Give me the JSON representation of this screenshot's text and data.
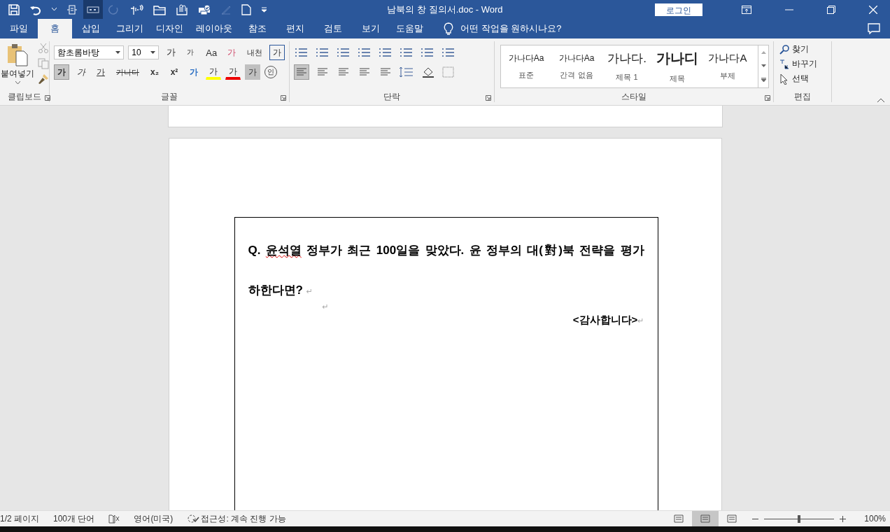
{
  "title_bar": {
    "title": "남북의 창 질의서.doc  -  Word",
    "login": "로그인"
  },
  "tabs": [
    {
      "label": "파일",
      "selected": false
    },
    {
      "label": "홈",
      "selected": true
    },
    {
      "label": "삽입",
      "selected": false
    },
    {
      "label": "그리기",
      "selected": false
    },
    {
      "label": "디자인",
      "selected": false
    },
    {
      "label": "레이아웃",
      "selected": false
    },
    {
      "label": "참조",
      "selected": false
    },
    {
      "label": "편지",
      "selected": false
    },
    {
      "label": "검토",
      "selected": false
    },
    {
      "label": "보기",
      "selected": false
    },
    {
      "label": "도움말",
      "selected": false
    }
  ],
  "tell_me": "어떤 작업을 원하시나요?",
  "clipboard": {
    "paste": "붙여넣기",
    "group": "클립보드"
  },
  "font": {
    "name": "함초롬바탕",
    "size": "10",
    "group": "글꼴",
    "row1": [
      {
        "label": "가",
        "kind": "grow"
      },
      {
        "label": "가",
        "kind": "shrink"
      },
      {
        "label": "Aa",
        "kind": "case"
      },
      {
        "label": "가",
        "kind": "clear"
      },
      {
        "label": "내천",
        "kind": "phonetic"
      },
      {
        "label": "가",
        "kind": "border"
      }
    ],
    "row2": [
      {
        "label": "가",
        "kind": "bold",
        "selected": true
      },
      {
        "label": "가",
        "kind": "italic",
        "selected": false
      },
      {
        "label": "가",
        "kind": "underline",
        "selected": false
      },
      {
        "label": "가나다",
        "kind": "strike",
        "selected": false
      },
      {
        "label": "x₂",
        "kind": "sub",
        "selected": false
      },
      {
        "label": "x²",
        "kind": "sup",
        "selected": false
      },
      {
        "label": "가",
        "kind": "effect",
        "selected": false
      },
      {
        "label": "가",
        "kind": "highlight",
        "selected": false
      },
      {
        "label": "가",
        "kind": "color",
        "selected": false
      },
      {
        "label": "가",
        "kind": "shade",
        "selected": false
      },
      {
        "label": "인",
        "kind": "enclose",
        "selected": false
      }
    ]
  },
  "paragraph": {
    "group": "단락",
    "align": [
      {
        "selected": true
      },
      {
        "selected": false
      },
      {
        "selected": false
      },
      {
        "selected": false
      },
      {
        "selected": false
      }
    ]
  },
  "styles": {
    "group": "스타일",
    "items": [
      {
        "preview": "가나다Aa",
        "name": "표준",
        "kind": "small"
      },
      {
        "preview": "가나다Aa",
        "name": "간격 없음",
        "kind": "small"
      },
      {
        "preview": "가나다.",
        "name": "제목 1",
        "kind": "heading"
      },
      {
        "preview": "가나디",
        "name": "제목",
        "kind": "title"
      },
      {
        "preview": "가나다A",
        "name": "부제",
        "kind": "subtitle"
      }
    ]
  },
  "editing": {
    "group": "편집",
    "items": [
      {
        "label": "찾기",
        "kind": "find"
      },
      {
        "label": "바꾸기",
        "kind": "replace"
      },
      {
        "label": "선택",
        "kind": "select"
      }
    ]
  },
  "document": {
    "paragraphs": [
      {
        "kind": "question",
        "prefix": "Q.",
        "flagged": "윤석열",
        "text": " 정부가 최근 100일을 맞았다. 윤 정부의 대(對)북 전략을 평가",
        "continuation": "하한다면?",
        "mark": "↵"
      },
      {
        "kind": "empty",
        "mark": "↵"
      },
      {
        "kind": "closing",
        "text": "<감사합니다>",
        "mark": "↵"
      }
    ]
  },
  "status_bar": {
    "page": "1/2 페이지",
    "words": "100개 단어",
    "language": "영어(미국)",
    "accessibility": "접근성: 계속 진행 가능",
    "views": [
      {
        "selected": false
      },
      {
        "selected": true
      },
      {
        "selected": false
      }
    ],
    "zoom": {
      "level": 0.5,
      "reading": "100%"
    }
  }
}
